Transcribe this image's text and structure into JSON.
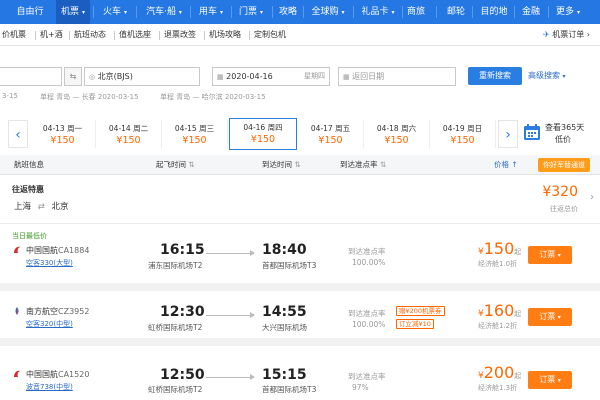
{
  "topnav": {
    "items": [
      "自由行",
      "机票",
      "火车",
      "汽车·船",
      "用车",
      "门票",
      "攻略",
      "全球购",
      "礼品卡",
      "商旅",
      "邮轮",
      "目的地",
      "金融",
      "更多"
    ]
  },
  "subnav": {
    "items": [
      "价机票",
      "机+酒",
      "航班动态",
      "值机选座",
      "退票改签",
      "机场攻略",
      "定制包机"
    ],
    "right": "机票订单"
  },
  "search": {
    "from_value": "",
    "to_value": "北京(BJS)",
    "date_value": "2020-04-16",
    "date_weekday": "星期四",
    "return_placeholder": "返回日期",
    "search_button": "重新搜索",
    "advanced": "高级搜索",
    "history": [
      "3-15",
      "单程 青岛 — 长春 2020-03-15",
      "单程 青岛 — 哈尔滨 2020-03-15"
    ]
  },
  "dates": [
    {
      "date": "04-13 周一",
      "price": "¥150"
    },
    {
      "date": "04-14 周二",
      "price": "¥150"
    },
    {
      "date": "04-15 周三",
      "price": "¥150"
    },
    {
      "date": "04-16 周四",
      "price": "¥150"
    },
    {
      "date": "04-17 周五",
      "price": "¥150"
    },
    {
      "date": "04-18 周六",
      "price": "¥150"
    },
    {
      "date": "04-19 周日",
      "price": "¥150"
    }
  ],
  "calendar": {
    "line1": "查看365天",
    "line2": "低价"
  },
  "table_header": {
    "info": "航班信息",
    "depart": "起飞时间",
    "arrive": "到达时间",
    "ontime": "到达准点率",
    "price": "价格",
    "recommend": "你好军替通道"
  },
  "roundtrip": {
    "label": "往返特惠",
    "from": "上海",
    "to": "北京",
    "price": "¥320",
    "sub": "往返总价"
  },
  "flights": [
    {
      "tag": "当日最低价",
      "airline": "中国国航",
      "flight_no": "CA1884",
      "plane": "空客330(大型)",
      "dep_time": "16:15",
      "dep_airport": "浦东国际机场T2",
      "arr_time": "18:40",
      "arr_airport": "首都国际机场T3",
      "ontime_label": "到达准点率",
      "ontime_rate": "100.00%",
      "promos": [],
      "price": "150",
      "price_suffix": "起",
      "discount": "经济舱1.0折",
      "book": "订票",
      "logo_color": "#d62b2b"
    },
    {
      "tag": "",
      "airline": "南方航空",
      "flight_no": "CZ3952",
      "plane": "空客320(中型)",
      "dep_time": "12:30",
      "dep_airport": "虹桥国际机场T2",
      "arr_time": "14:55",
      "arr_airport": "大兴国际机场",
      "ontime_label": "到达准点率",
      "ontime_rate": "100.00%",
      "promos": [
        "赠¥200机票券",
        "订立减¥10"
      ],
      "price": "160",
      "price_suffix": "起",
      "discount": "经济舱1.2折",
      "book": "订票",
      "logo_color": "#1a6fc9"
    },
    {
      "tag": "",
      "airline": "中国国航",
      "flight_no": "CA1520",
      "plane": "波音738(中型)",
      "dep_time": "12:50",
      "dep_airport": "虹桥国际机场T2",
      "arr_time": "15:15",
      "arr_airport": "首都国际机场T3",
      "ontime_label": "到达准点率",
      "ontime_rate": "97%",
      "promos": [],
      "price": "200",
      "price_suffix": "起",
      "discount": "经济舱1.3折",
      "book": "订票",
      "logo_color": "#d62b2b"
    }
  ]
}
